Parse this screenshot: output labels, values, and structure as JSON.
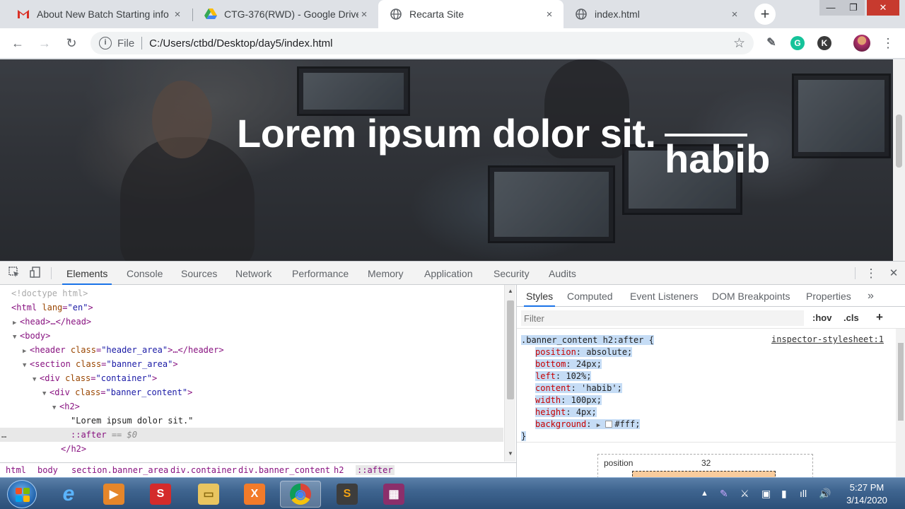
{
  "browser": {
    "tabs": [
      {
        "title": "About New Batch Starting info",
        "icon": "gmail-icon",
        "close": "×"
      },
      {
        "title": "CTG-376(RWD) - Google Drive",
        "icon": "google-drive-icon",
        "close": "×"
      },
      {
        "title": "Recarta Site",
        "icon": "globe-icon",
        "close": "×"
      },
      {
        "title": "index.html",
        "icon": "globe-icon",
        "close": "×"
      }
    ],
    "new_tab": "+",
    "window_controls": {
      "minimize": "—",
      "maximize": "❐",
      "close": "✕"
    },
    "nav": {
      "back": "←",
      "forward": "→",
      "reload": "↻"
    },
    "address": {
      "scheme": "File",
      "url": "C:/Users/ctbd/Desktop/day5/index.html",
      "info": "i"
    },
    "star": "☆",
    "extensions": [
      {
        "name": "eyedropper-icon",
        "label": "✎",
        "color": "#5f6368"
      },
      {
        "name": "grammarly-icon",
        "label": "G",
        "color": "#15c39a"
      },
      {
        "name": "k-extension-icon",
        "label": "K",
        "color": "#3a3a3a"
      }
    ],
    "menu": "⋮"
  },
  "page": {
    "heading": "Lorem ipsum dolor sit.",
    "after_content": "habib"
  },
  "devtools": {
    "tabs": [
      "Elements",
      "Console",
      "Sources",
      "Network",
      "Performance",
      "Memory",
      "Application",
      "Security",
      "Audits"
    ],
    "active_tab": "Elements",
    "menu": "⋮",
    "close": "✕",
    "dom": {
      "doctype": "<!doctype html>",
      "html_tag": "html",
      "html_attr": "lang",
      "html_val": "\"en\"",
      "head": "<head>…</head>",
      "body": "<body>",
      "header_tag": "header",
      "header_attr": "class",
      "header_val": "\"header_area\"",
      "header_close": ">…</header>",
      "section_tag": "section",
      "section_val": "\"banner_area\"",
      "container_val": "\"container\"",
      "banner_content_val": "\"banner_content\"",
      "h2_open": "<h2>",
      "h2_text": "\"Lorem ipsum dolor sit.\"",
      "after_pseudo": "::after",
      "after_marker": "== $0",
      "h2_close": "</h2>",
      "div_tag": "div",
      "class_attr": "class",
      "ellipsis": "…"
    },
    "breadcrumbs": [
      "html",
      "body",
      "section.banner_area",
      "div.container",
      "div.banner_content",
      "h2",
      "::after"
    ],
    "styles_tabs": [
      "Styles",
      "Computed",
      "Event Listeners",
      "DOM Breakpoints",
      "Properties"
    ],
    "styles_more": "»",
    "filter": {
      "placeholder": "Filter",
      "hov": ":hov",
      "cls": ".cls",
      "add": "+"
    },
    "rule": {
      "selector": ".banner_content h2:after {",
      "source": "inspector-stylesheet:1",
      "declarations": [
        {
          "name": "position",
          "value": "absolute;"
        },
        {
          "name": "bottom",
          "value": "24px;"
        },
        {
          "name": "left",
          "value": "102%;"
        },
        {
          "name": "content",
          "value": "'habib';"
        },
        {
          "name": "width",
          "value": "100px;"
        },
        {
          "name": "height",
          "value": "4px;"
        }
      ],
      "background_name": "background",
      "background_value": "#fff;",
      "close": "}"
    },
    "box_model": {
      "label": "position",
      "value": "32"
    }
  },
  "taskbar": {
    "apps": [
      {
        "name": "internet-explorer-icon",
        "glyph": "e",
        "color": "#1e7bd6"
      },
      {
        "name": "media-player-icon",
        "glyph": "▶",
        "color": "#e5862a"
      },
      {
        "name": "office-icon",
        "glyph": "S",
        "color": "#d42b2b"
      },
      {
        "name": "file-explorer-icon",
        "glyph": "▭",
        "color": "#e9c560"
      },
      {
        "name": "xampp-icon",
        "glyph": "X",
        "color": "#f27b2a"
      },
      {
        "name": "chrome-icon",
        "glyph": "◉",
        "color": "#3c8c3c"
      },
      {
        "name": "sublime-text-icon",
        "glyph": "S",
        "color": "#f3a213"
      },
      {
        "name": "winrar-icon",
        "glyph": "▦",
        "color": "#8b2f6b"
      }
    ],
    "tray": [
      "▲",
      "✎",
      "⚔",
      "▣",
      "▮",
      "ıll",
      "🔊"
    ],
    "time": "5:27 PM",
    "date": "3/14/2020"
  }
}
